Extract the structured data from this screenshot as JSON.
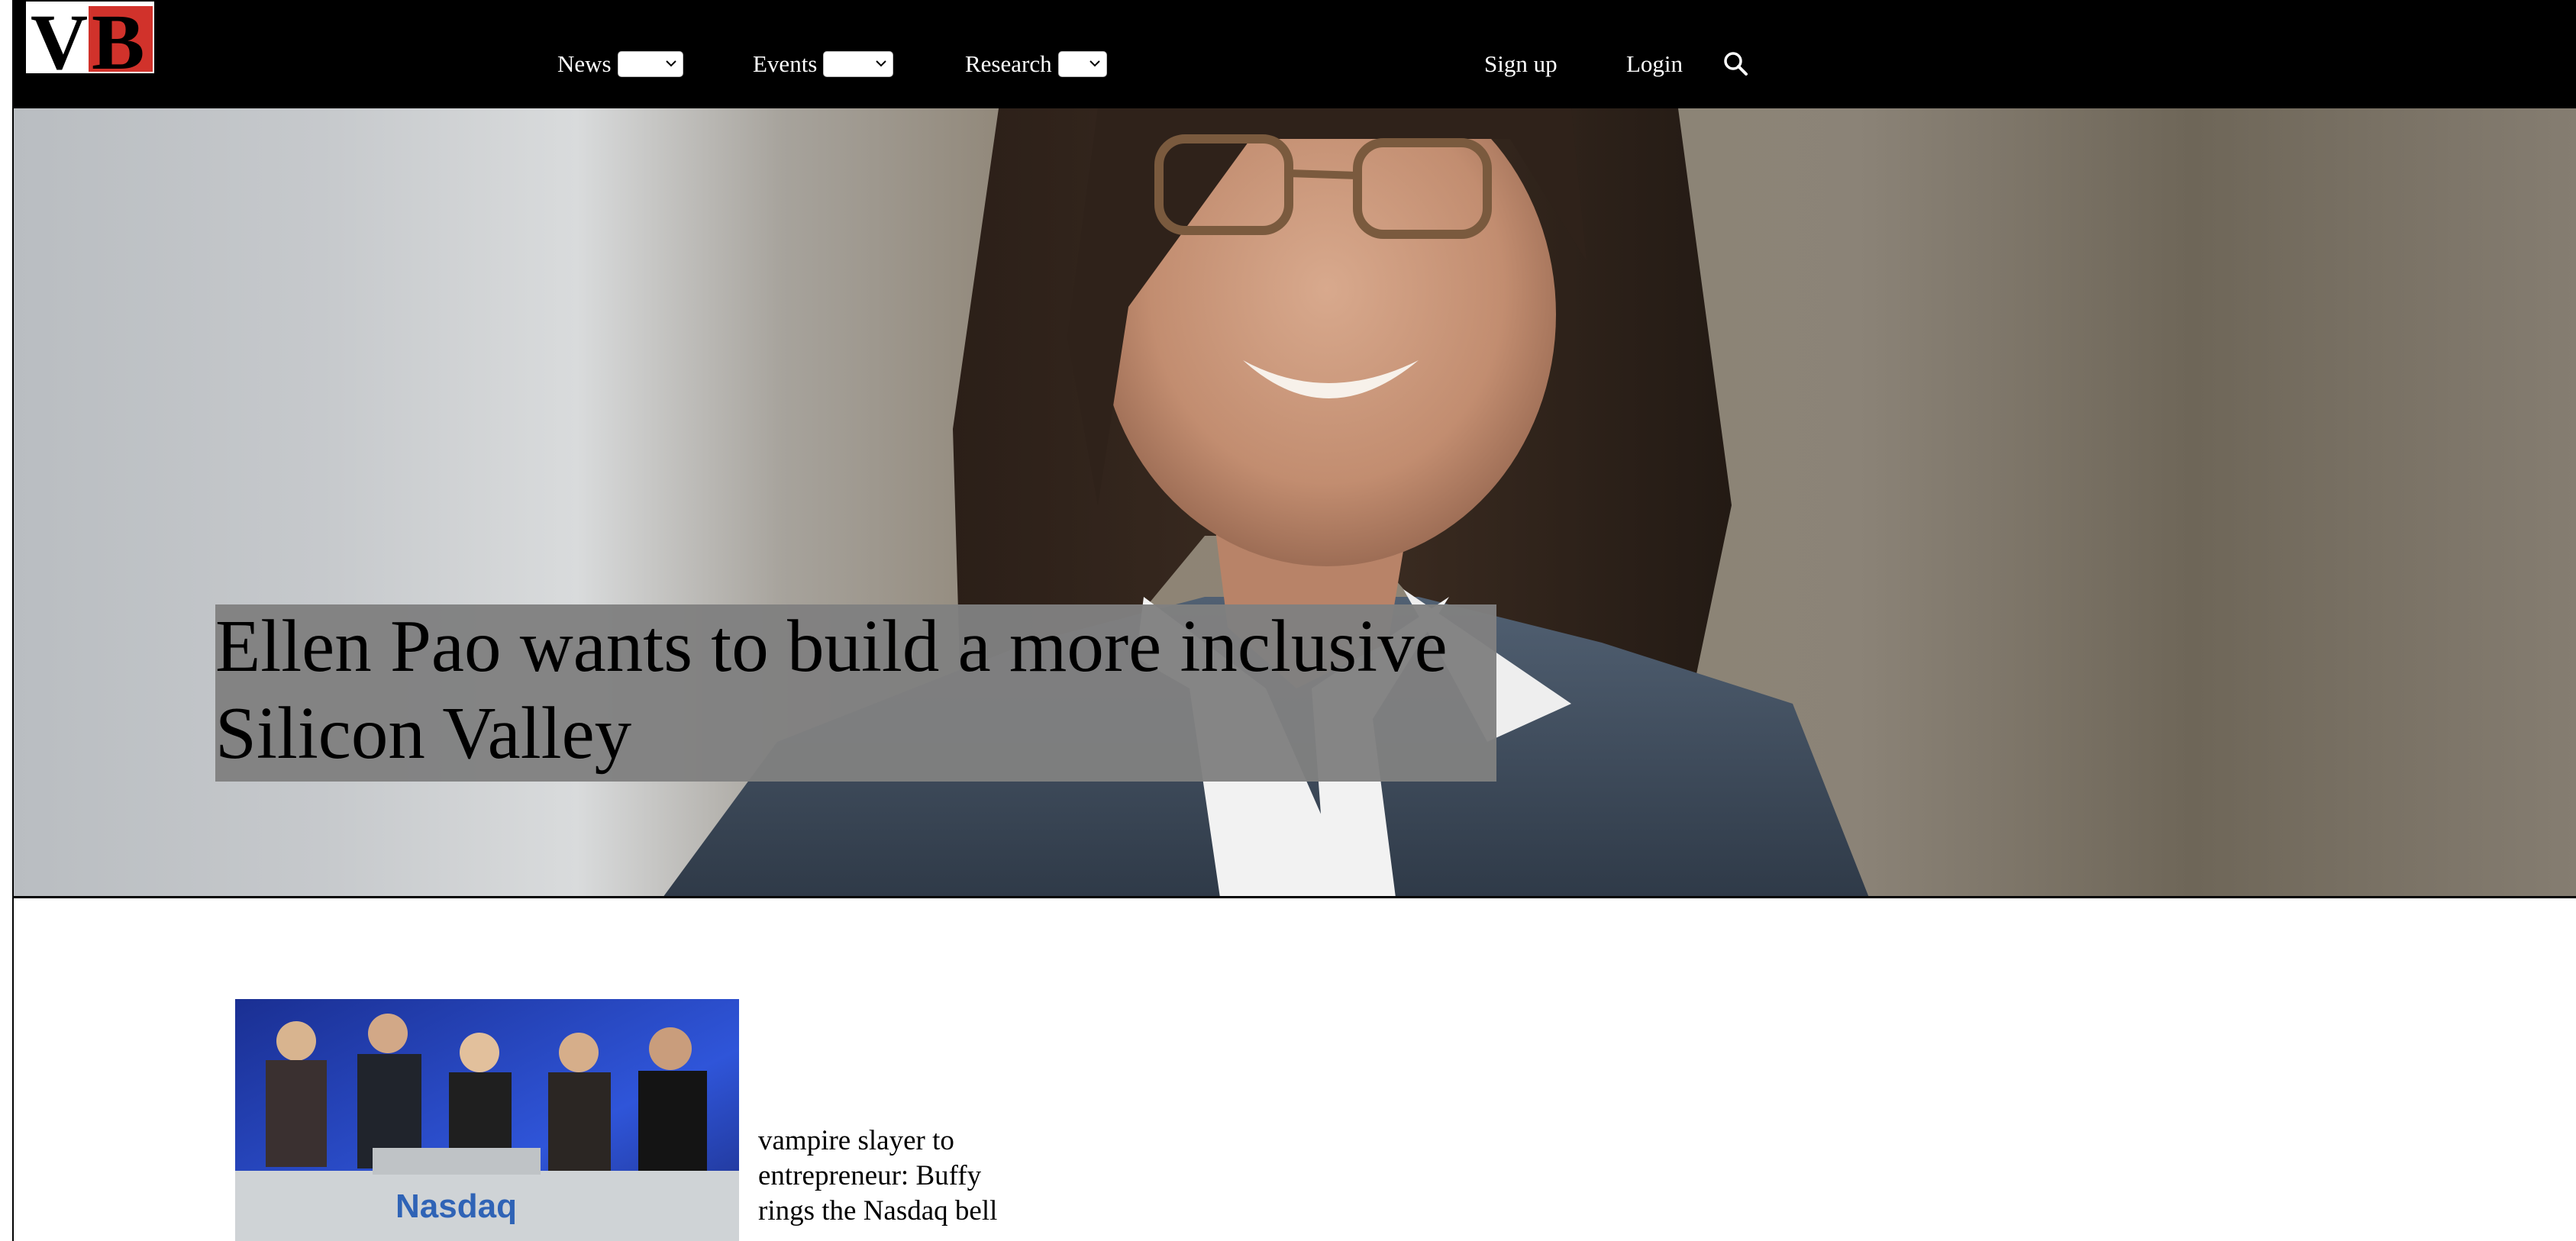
{
  "header": {
    "logo_text": "VB",
    "nav": [
      {
        "label": "News"
      },
      {
        "label": "Events"
      },
      {
        "label": "Research"
      }
    ],
    "signup_label": "Sign up",
    "login_label": "Login",
    "search_icon": "search-icon",
    "colors": {
      "bar": "#000000",
      "logo_red": "#d1322b"
    }
  },
  "hero": {
    "headline": "Ellen Pao wants to build a more inclusive Silicon Valley",
    "headline_background": "#808080"
  },
  "stories": [
    {
      "title": "vampire slayer to entrepreneur: Buffy rings the Nasdaq bell",
      "image_text": "Nasdaq"
    }
  ]
}
